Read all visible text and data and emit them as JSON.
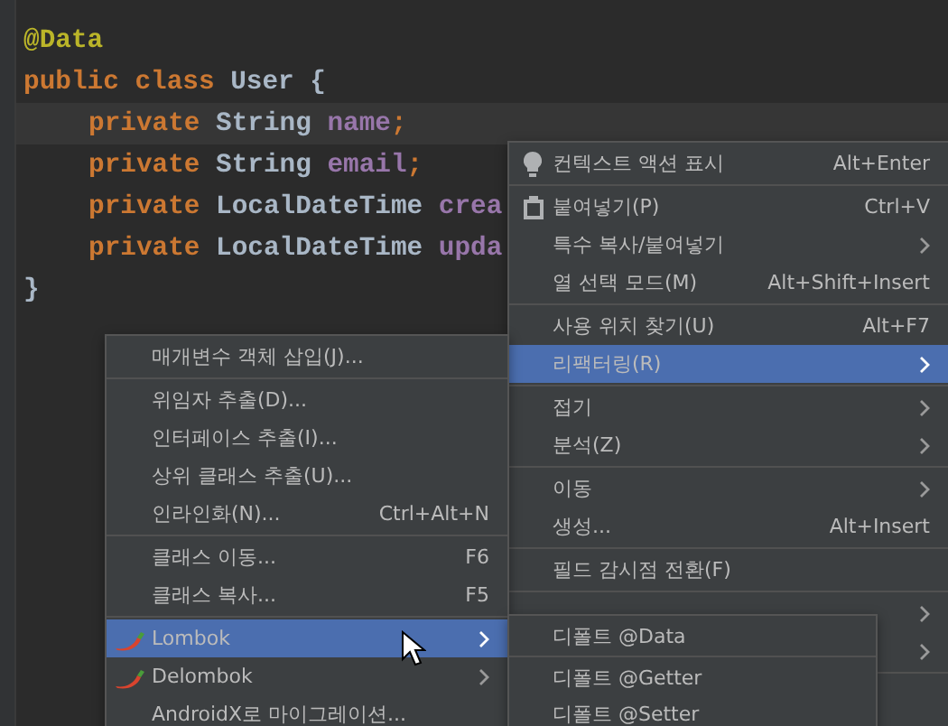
{
  "editor": {
    "lines": [
      {
        "current": false,
        "tokens": [
          {
            "kind": "annotation",
            "text": "@Data"
          }
        ]
      },
      {
        "current": false,
        "tokens": [
          {
            "kind": "keyword",
            "text": "public"
          },
          {
            "kind": "keyword",
            "text": "class"
          },
          {
            "kind": "type",
            "text": "User"
          },
          {
            "kind": "plain",
            "text": "{"
          }
        ],
        "children": [
          {
            "current": true,
            "tokens": [
              {
                "kind": "keyword",
                "text": "private"
              },
              {
                "kind": "type",
                "text": "String"
              },
              {
                "kind": "field",
                "text": "name"
              },
              {
                "kind": "punct",
                "text": ";"
              }
            ]
          },
          {
            "current": false,
            "tokens": [
              {
                "kind": "keyword",
                "text": "private"
              },
              {
                "kind": "type",
                "text": "String"
              },
              {
                "kind": "field",
                "text": "email"
              },
              {
                "kind": "punct",
                "text": ";"
              }
            ]
          },
          {
            "current": false,
            "tokens": [
              {
                "kind": "keyword",
                "text": "private"
              },
              {
                "kind": "type",
                "text": "LocalDateTime"
              },
              {
                "kind": "field",
                "text": "crea"
              }
            ]
          },
          {
            "current": false,
            "tokens": [
              {
                "kind": "keyword",
                "text": "private"
              },
              {
                "kind": "type",
                "text": "LocalDateTime"
              },
              {
                "kind": "field",
                "text": "upda"
              }
            ]
          }
        ]
      },
      {
        "current": false,
        "tokens": [
          {
            "kind": "plain",
            "text": "}"
          }
        ]
      }
    ]
  },
  "context_menu": {
    "items": [
      {
        "kind": "action",
        "label": "컨텍스트 액션 표시",
        "shortcut": "Alt+Enter",
        "submenu": false,
        "selected": false
      },
      {
        "kind": "separator"
      },
      {
        "kind": "paste",
        "label": "붙여넣기(P)",
        "shortcut": "Ctrl+V",
        "submenu": false,
        "selected": false
      },
      {
        "kind": "item",
        "label": "특수 복사/붙여넣기",
        "submenu": true,
        "selected": false
      },
      {
        "kind": "item",
        "label": "열 선택 모드(M)",
        "shortcut": "Alt+Shift+Insert",
        "submenu": false,
        "selected": false
      },
      {
        "kind": "separator"
      },
      {
        "kind": "item",
        "label": "사용 위치 찾기(U)",
        "shortcut": "Alt+F7",
        "submenu": false,
        "selected": false
      },
      {
        "kind": "item",
        "label": "리팩터링(R)",
        "submenu": true,
        "selected": true
      },
      {
        "kind": "separator"
      },
      {
        "kind": "item",
        "label": "접기",
        "submenu": true,
        "selected": false
      },
      {
        "kind": "item",
        "label": "분석(Z)",
        "submenu": true,
        "selected": false
      },
      {
        "kind": "separator"
      },
      {
        "kind": "item",
        "label": "이동",
        "submenu": true,
        "selected": false
      },
      {
        "kind": "item",
        "label": "생성...",
        "shortcut": "Alt+Insert",
        "submenu": false,
        "selected": false
      },
      {
        "kind": "separator"
      },
      {
        "kind": "item",
        "label": "필드 감시점 전환(F)",
        "submenu": false,
        "selected": false
      },
      {
        "kind": "separator"
      },
      {
        "kind": "item",
        "submenu": true,
        "selected": false
      },
      {
        "kind": "item",
        "submenu": true,
        "selected": false
      },
      {
        "kind": "separator"
      },
      {
        "kind": "item",
        "submenu": false,
        "selected": false
      }
    ]
  },
  "refactor_menu": {
    "items": [
      {
        "kind": "item",
        "label": "매개변수 객체 삽입(J)...",
        "submenu": false,
        "selected": false
      },
      {
        "kind": "separator"
      },
      {
        "kind": "item",
        "label": "위임자 추출(D)...",
        "submenu": false,
        "selected": false
      },
      {
        "kind": "item",
        "label": "인터페이스 추출(I)...",
        "submenu": false,
        "selected": false
      },
      {
        "kind": "item",
        "label": "상위 클래스 추출(U)...",
        "submenu": false,
        "selected": false
      },
      {
        "kind": "item",
        "label": "인라인화(N)...",
        "shortcut": "Ctrl+Alt+N",
        "submenu": false,
        "selected": false
      },
      {
        "kind": "separator"
      },
      {
        "kind": "item",
        "label": "클래스 이동...",
        "shortcut": "F6",
        "submenu": false,
        "selected": false
      },
      {
        "kind": "item",
        "label": "클래스 복사...",
        "shortcut": "F5",
        "submenu": false,
        "selected": false
      },
      {
        "kind": "separator"
      },
      {
        "kind": "plugin",
        "label": "Lombok",
        "submenu": true,
        "selected": true
      },
      {
        "kind": "plugin",
        "label": "Delombok",
        "submenu": true,
        "selected": false
      },
      {
        "kind": "item",
        "label": "AndroidX로 마이그레이션...",
        "submenu": false,
        "selected": false
      }
    ]
  },
  "lombok_menu": {
    "items": [
      {
        "kind": "item",
        "label": "디폴트 @Data",
        "submenu": false,
        "selected": false
      },
      {
        "kind": "separator"
      },
      {
        "kind": "item",
        "label": "디폴트 @Getter",
        "submenu": false,
        "selected": false
      },
      {
        "kind": "item",
        "label": "디폴트 @Setter",
        "submenu": false,
        "selected": false
      }
    ]
  }
}
